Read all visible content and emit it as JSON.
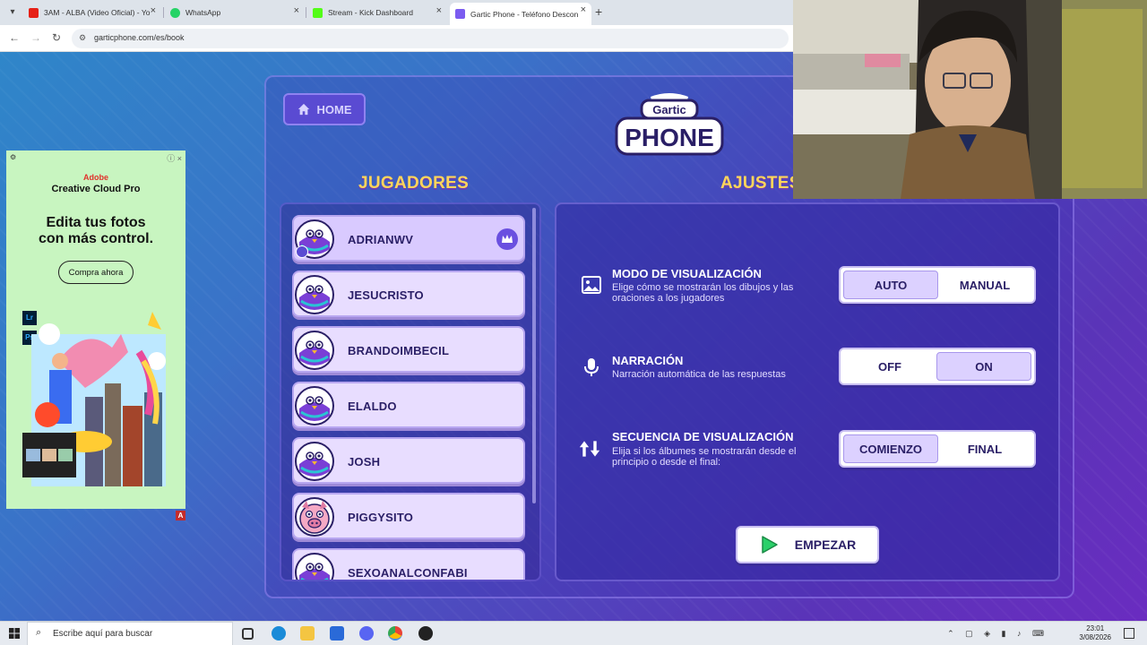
{
  "browser": {
    "tabs": [
      {
        "title": "3AM - ALBA (Video Oficial) - Yo",
        "color": "#e62117"
      },
      {
        "title": "WhatsApp",
        "color": "#25d366"
      },
      {
        "title": "Stream - Kick Dashboard",
        "color": "#53fc18"
      },
      {
        "title": "Gartic Phone - Teléfono Descon",
        "color": "#7b5cf0"
      }
    ],
    "url": "garticphone.com/es/book"
  },
  "game": {
    "home_label": "HOME",
    "logo_line1": "Gartic",
    "logo_line2": "PHONE",
    "players_title": "JUGADORES",
    "settings_title": "AJUSTES",
    "players": [
      {
        "name": "ADRIANWV",
        "avatar": "bird"
      },
      {
        "name": "JESUCRISTO",
        "avatar": "bird"
      },
      {
        "name": "BRANDOIMBECIL",
        "avatar": "bird"
      },
      {
        "name": "ELALDO",
        "avatar": "bird"
      },
      {
        "name": "JOSH",
        "avatar": "bird"
      },
      {
        "name": "PIGGYSITO",
        "avatar": "pig"
      },
      {
        "name": "SEXOANALCONFABI",
        "avatar": "bird"
      }
    ],
    "settings": [
      {
        "title": "MODO DE VISUALIZACIÓN",
        "desc": "Elige cómo se mostrarán los dibujos y las oraciones a los jugadores",
        "options": [
          "AUTO",
          "MANUAL"
        ],
        "selected": "AUTO",
        "icon": "image-icon"
      },
      {
        "title": "NARRACIÓN",
        "desc": "Narración automática de las respuestas",
        "options": [
          "OFF",
          "ON"
        ],
        "selected": "ON",
        "icon": "microphone-icon"
      },
      {
        "title": "SECUENCIA DE VISUALIZACIÓN",
        "desc": "Elija si los álbumes se mostrarán desde el principio o desde el final:",
        "options": [
          "COMIENZO",
          "FINAL"
        ],
        "selected": "COMIENZO",
        "icon": "sort-arrows-icon"
      }
    ],
    "start_label": "EMPEZAR"
  },
  "ad": {
    "brand": "Adobe",
    "product": "Creative Cloud Pro",
    "headline_1": "Edita tus fotos",
    "headline_2": "con más control.",
    "cta": "Compra ahora",
    "app_1": "Lr",
    "app_2": "Ps",
    "mark": "A"
  },
  "taskbar": {
    "search_placeholder": "Escribe aquí para buscar",
    "time": "23:01",
    "date": "3/08/2026"
  }
}
